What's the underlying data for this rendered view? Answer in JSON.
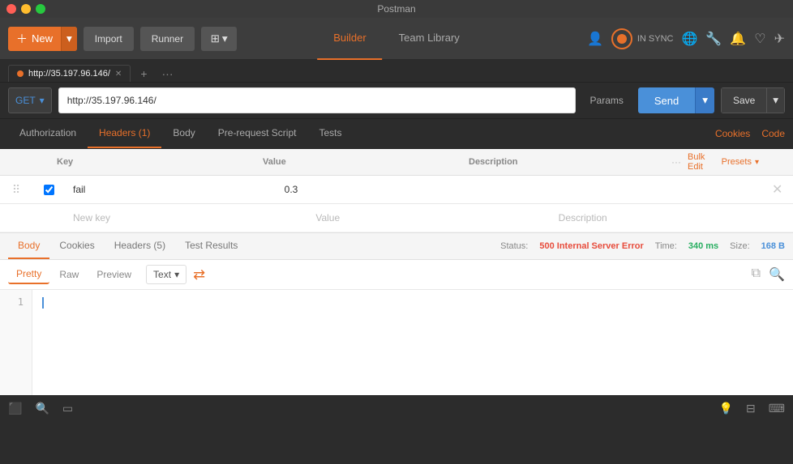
{
  "titlebar": {
    "title": "Postman"
  },
  "toolbar": {
    "new_label": "New",
    "import_label": "Import",
    "runner_label": "Runner",
    "builder_tab": "Builder",
    "team_library_tab": "Team Library",
    "sync_label": "IN SYNC"
  },
  "url_tab": {
    "label": "http://35.197.96.146/",
    "add_label": "+",
    "more_label": "···"
  },
  "url_bar": {
    "method": "GET",
    "url": "http://35.197.96.146/",
    "params_label": "Params",
    "send_label": "Send",
    "save_label": "Save"
  },
  "request_tabs": {
    "authorization": "Authorization",
    "headers": "Headers (1)",
    "body": "Body",
    "pre_request": "Pre-request Script",
    "tests": "Tests",
    "cookies_link": "Cookies",
    "code_link": "Code"
  },
  "headers_table": {
    "col_key": "Key",
    "col_value": "Value",
    "col_description": "Description",
    "bulk_edit": "Bulk Edit",
    "presets": "Presets",
    "rows": [
      {
        "checked": true,
        "key": "fail",
        "value": "0.3",
        "description": ""
      }
    ],
    "new_row": {
      "key_placeholder": "New key",
      "value_placeholder": "Value",
      "description_placeholder": "Description"
    }
  },
  "response": {
    "body_tab": "Body",
    "cookies_tab": "Cookies",
    "headers_tab": "Headers (5)",
    "test_results_tab": "Test Results",
    "status_label": "Status:",
    "status_value": "500 Internal Server Error",
    "time_label": "Time:",
    "time_value": "340 ms",
    "size_label": "Size:",
    "size_value": "168 B",
    "pretty_tab": "Pretty",
    "raw_tab": "Raw",
    "preview_tab": "Preview",
    "format_label": "Text",
    "line_number": "1"
  },
  "bottom_bar": {
    "icons": [
      "console",
      "search",
      "runner"
    ]
  },
  "colors": {
    "orange": "#e8702a",
    "blue": "#4a90d9",
    "red": "#e74c3c",
    "green": "#27ae60"
  }
}
